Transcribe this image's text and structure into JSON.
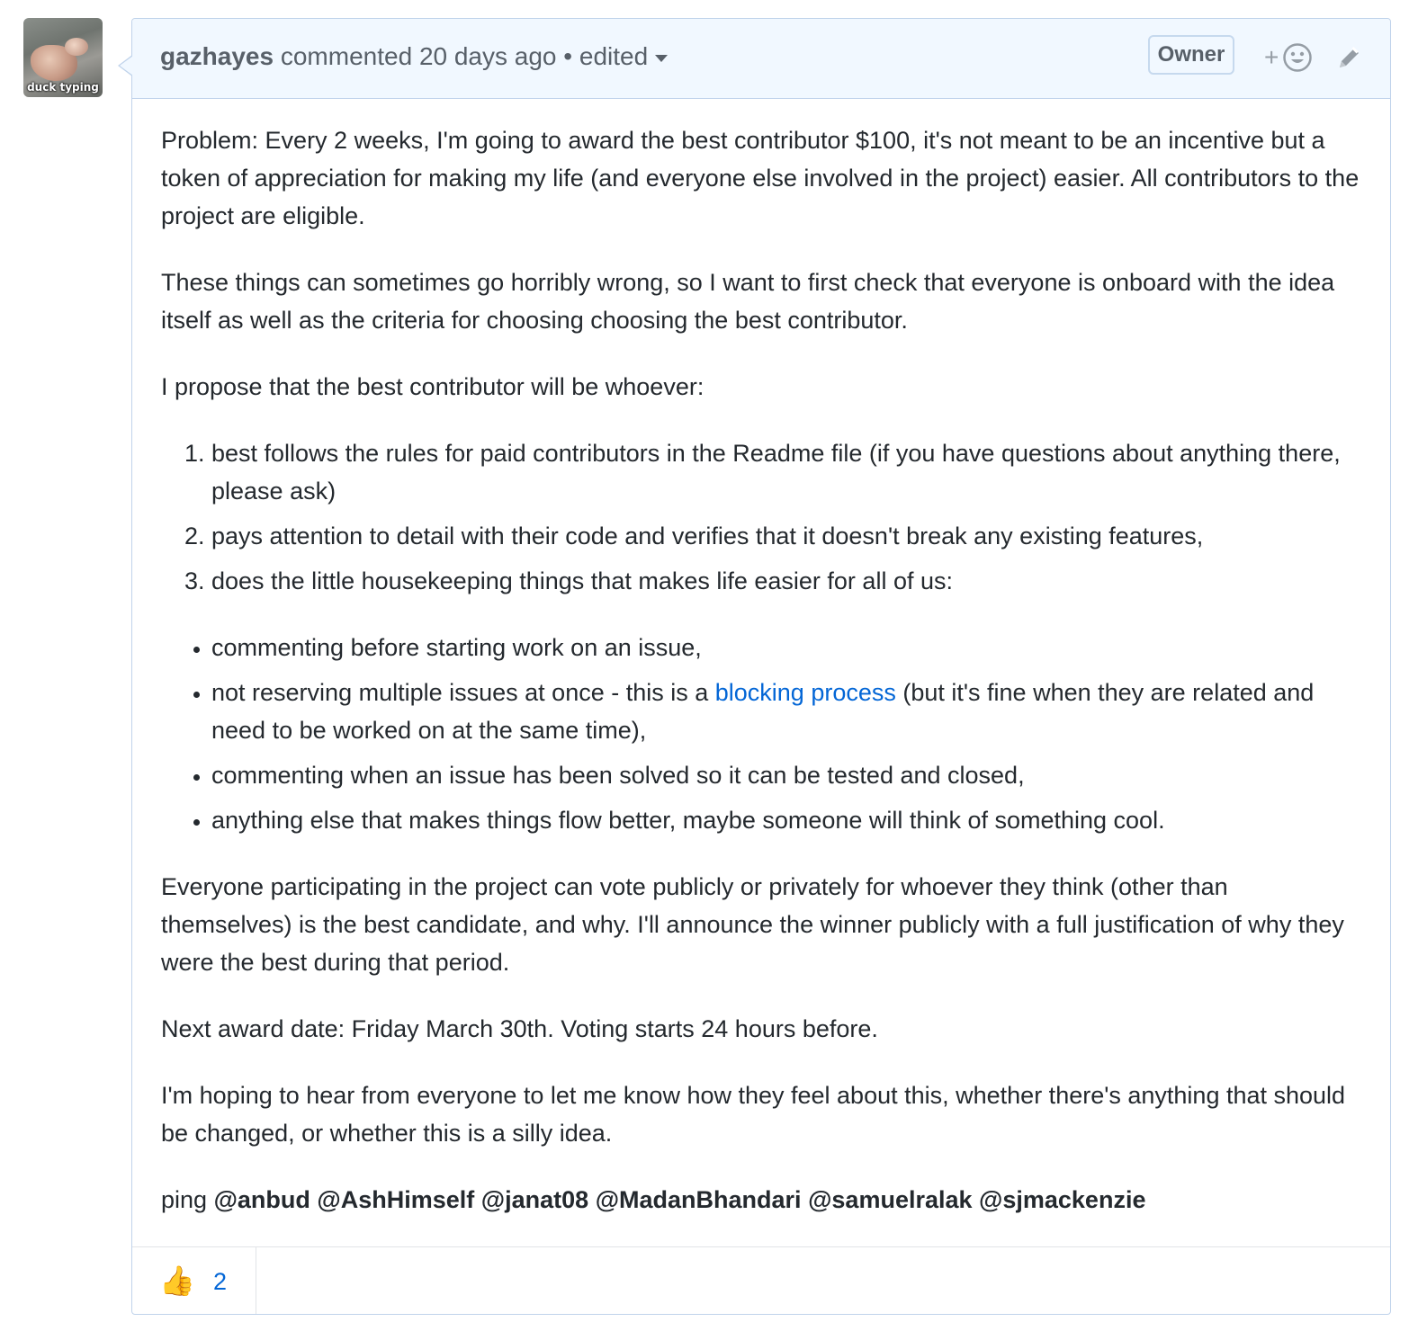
{
  "avatar": {
    "caption": "duck typing"
  },
  "header": {
    "author": "gazhayes",
    "action": "commented",
    "time": "20 days ago",
    "separator": "•",
    "edited": "edited",
    "badge": "Owner",
    "add_reaction": "+"
  },
  "body": {
    "p1": "Problem: Every 2 weeks, I'm going to award the best contributor $100, it's not meant to be an incentive but a token of appreciation for making my life (and everyone else involved in the project) easier. All contributors to the project are eligible.",
    "p2": "These things can sometimes go horribly wrong, so I want to first check that everyone is onboard with the idea itself as well as the criteria for choosing choosing the best contributor.",
    "p3": "I propose that the best contributor will be whoever:",
    "ordered": [
      "best follows the rules for paid contributors in the Readme file (if you have questions about anything there, please ask)",
      "pays attention to detail with their code and verifies that it doesn't break any existing features,",
      "does the little housekeeping things that makes life easier for all of us:"
    ],
    "bullets": {
      "b1": "commenting before starting work on an issue,",
      "b2_before": "not reserving multiple issues at once - this is a ",
      "b2_link": "blocking process",
      "b2_after": " (but it's fine when they are related and need to be worked on at the same time),",
      "b3": "commenting when an issue has been solved so it can be tested and closed,",
      "b4": "anything else that makes things flow better, maybe someone will think of something cool."
    },
    "p4": "Everyone participating in the project can vote publicly or privately for whoever they think (other than themselves) is the best candidate, and why. I'll announce the winner publicly with a full justification of why they were the best during that period.",
    "p5": "Next award date: Friday March 30th. Voting starts 24 hours before.",
    "p6": "I'm hoping to hear from everyone to let me know how they feel about this, whether there's anything that should be changed, or whether this is a silly idea.",
    "ping_label": "ping",
    "mentions": [
      "@anbud",
      "@AshHimself",
      "@janat08",
      "@MadanBhandari",
      "@samuelralak",
      "@sjmackenzie"
    ]
  },
  "reactions": {
    "thumbs_up_emoji": "👍",
    "thumbs_up_count": "2"
  },
  "colors": {
    "link": "#0366d6",
    "header_bg": "#f1f8ff",
    "border": "#c0d3eb"
  }
}
